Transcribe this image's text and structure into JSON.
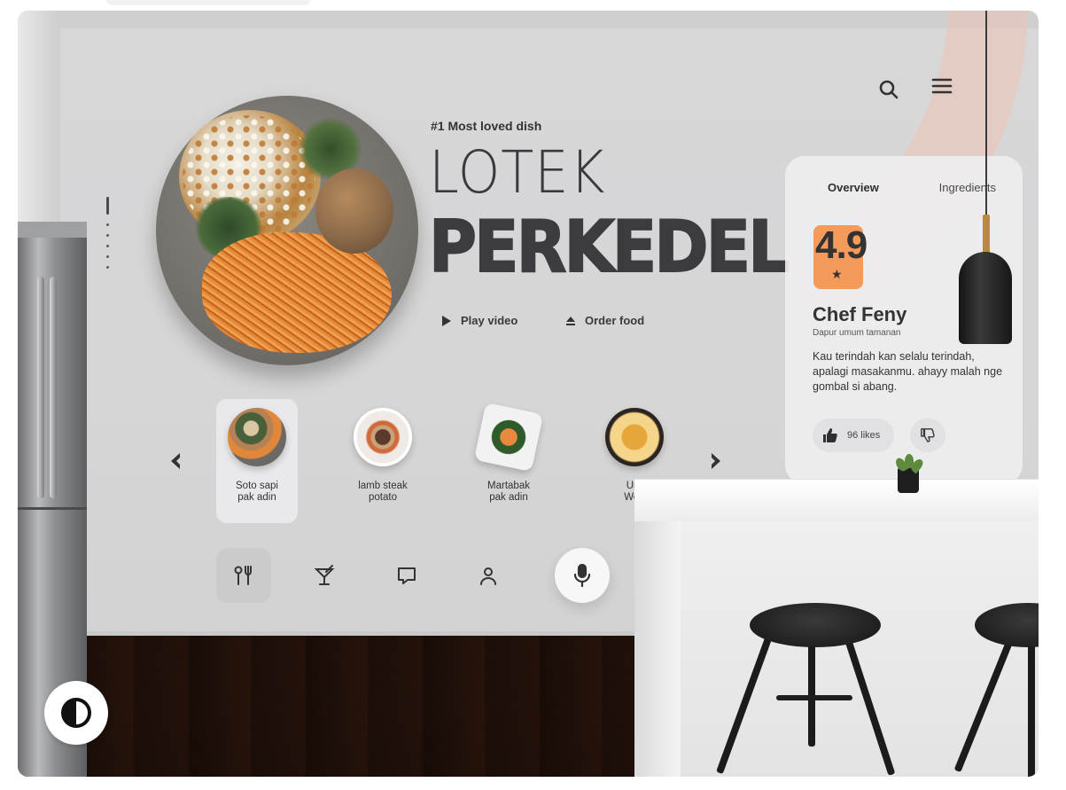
{
  "hero": {
    "eyebrow": "#1 Most loved dish",
    "title_line1": "LOTEK",
    "title_line2": "PERKEDEL",
    "actions": [
      {
        "label": "Play video",
        "icon": "play-icon"
      },
      {
        "label": "Order food",
        "icon": "eject-icon"
      }
    ]
  },
  "header": {
    "icons": [
      "search-icon",
      "menu-icon"
    ]
  },
  "carousel": {
    "items": [
      {
        "line1": "Soto sapi",
        "line2": "pak adin",
        "selected": true
      },
      {
        "line1": "lamb steak",
        "line2": "potato",
        "selected": false
      },
      {
        "line1": "Martabak",
        "line2": "pak adin",
        "selected": false
      },
      {
        "line1": "Ura",
        "line2": "Won",
        "selected": false
      }
    ],
    "prev_icon": "chevron-left-icon",
    "next_icon": "chevron-right-icon"
  },
  "bottom_nav": {
    "items": [
      "utensils-icon",
      "cocktail-icon",
      "chat-icon",
      "user-icon"
    ],
    "active_index": 0,
    "mic_icon": "microphone-icon"
  },
  "detail": {
    "tabs": [
      "Overview",
      "Ingredients"
    ],
    "active_tab": 0,
    "rating": "4.9",
    "chef_name": "Chef Feny",
    "chef_subtitle": "Dapur umum tamanan",
    "description": "Kau terindah kan selalu terindah, apalagi masakanmu. ahayy malah nge gombal si abang.",
    "likes_label": "96 likes"
  },
  "colors": {
    "accent_orange": "#f49a5a",
    "text_dark": "#333333"
  },
  "theme_toggle_icon": "contrast-icon"
}
